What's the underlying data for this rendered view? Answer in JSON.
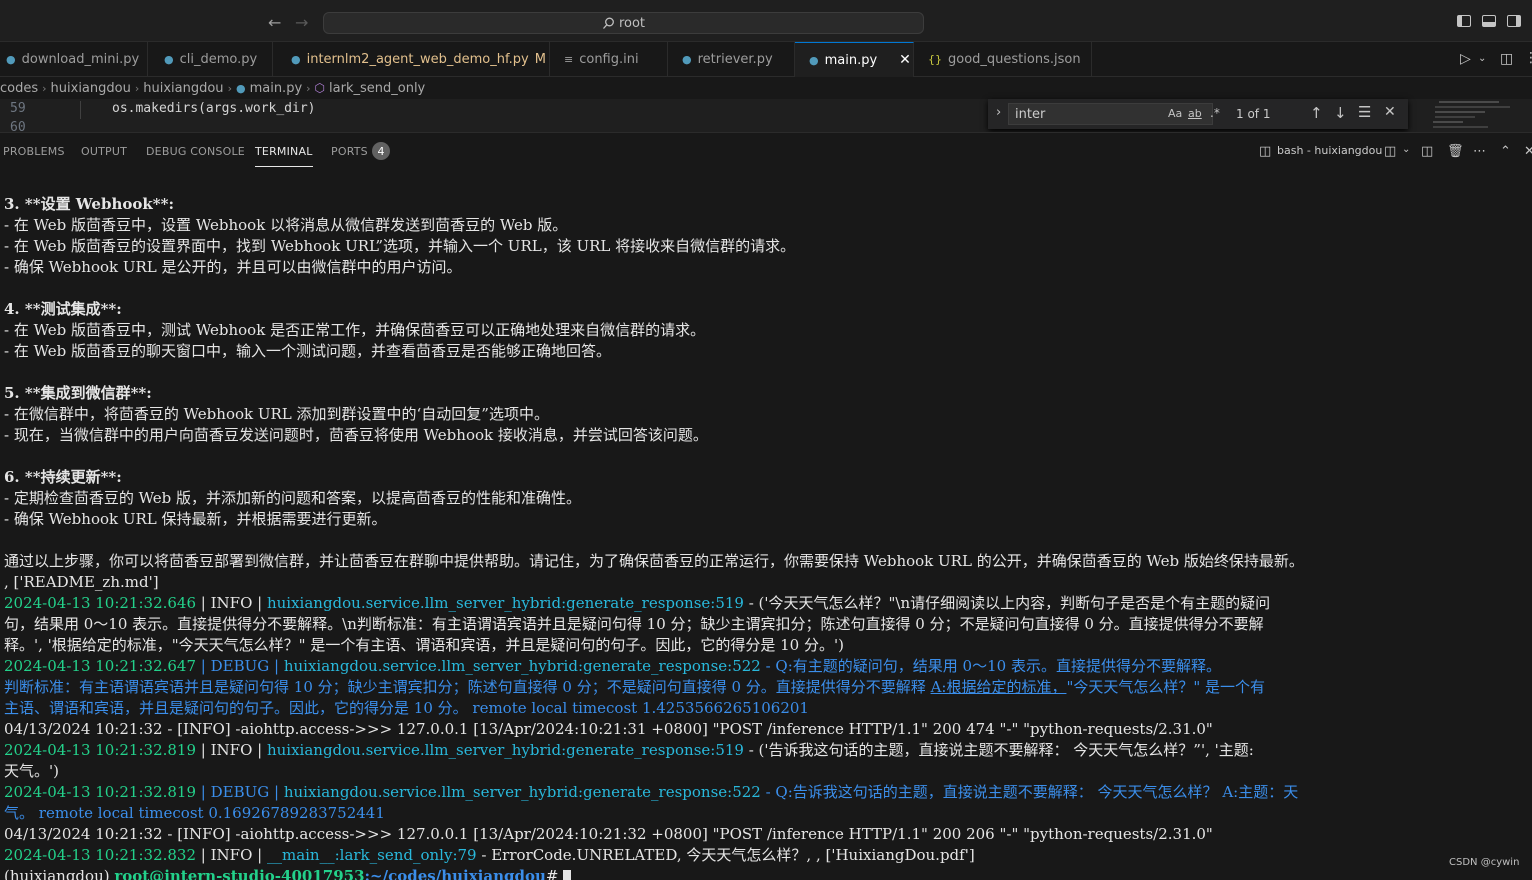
{
  "titlebar": {
    "search": "root"
  },
  "tabs": [
    {
      "label": "download_mini.py",
      "type": "py"
    },
    {
      "label": "cli_demo.py",
      "type": "py"
    },
    {
      "label": "internlm2_agent_web_demo_hf.py",
      "type": "py",
      "badge": "M"
    },
    {
      "label": "config.ini",
      "type": "ini"
    },
    {
      "label": "retriever.py",
      "type": "py"
    },
    {
      "label": "main.py",
      "type": "py",
      "active": true
    },
    {
      "label": "good_questions.json",
      "type": "json"
    }
  ],
  "breadcrumb": [
    "codes",
    "huixiangdou",
    "huixiangdou",
    "main.py",
    "lark_send_only"
  ],
  "editor": {
    "lines": [
      {
        "num": "59",
        "code": "os.makedirs(args.work_dir)"
      },
      {
        "num": "60",
        "code": ""
      }
    ]
  },
  "find": {
    "value": "inter",
    "case": "Aa",
    "word": "ab",
    "regex": ".*",
    "result": "1 of 1"
  },
  "panel": {
    "tabs": [
      "PROBLEMS",
      "OUTPUT",
      "DEBUG CONSOLE",
      "TERMINAL",
      "PORTS"
    ],
    "ports_count": "4",
    "shell": "bash - huixiangdou"
  },
  "terminal": {
    "l1": "3. **设置 Webhook**:",
    "l2": "   - 在 Web 版茴香豆中，设置 Webhook 以将消息从微信群发送到茴香豆的 Web 版。",
    "l3": "   - 在 Web 版茴香豆的设置界面中，找到 Webhook URL”选项，并输入一个 URL，该 URL 将接收来自微信群的请求。",
    "l4": "   - 确保 Webhook URL 是公开的，并且可以由微信群中的用户访问。",
    "l5": "4. **测试集成**:",
    "l6": "   - 在 Web 版茴香豆中，测试 Webhook 是否正常工作，并确保茴香豆可以正确地处理来自微信群的请求。",
    "l7": "   - 在 Web 版茴香豆的聊天窗口中，输入一个测试问题，并查看茴香豆是否能够正确地回答。",
    "l8": "5. **集成到微信群**:",
    "l9": "   - 在微信群中，将茴香豆的 Webhook URL 添加到群设置中的‘自动回复”选项中。",
    "l10": "   - 现在，当微信群中的用户向茴香豆发送问题时，茴香豆将使用 Webhook 接收消息，并尝试回答该问题。",
    "l11": "6. **持续更新**:",
    "l12": "   - 定期检查茴香豆的 Web 版，并添加新的问题和答案，以提高茴香豆的性能和准确性。",
    "l13": "   - 确保 Webhook URL 保持最新，并根据需要进行更新。",
    "l14": "通过以上步骤，你可以将茴香豆部署到微信群，并让茴香豆在群聊中提供帮助。请记住，为了确保茴香豆的正常运行，你需要保持 Webhook URL 的公开，并确保茴香豆的 Web 版始终保持最新。",
    "l15": ", ['README_zh.md']",
    "log1_ts": "2024-04-13 10:21:32.646",
    "log1_lvl": " | INFO     | ",
    "log1_src": "huixiangdou.service.llm_server_hybrid:generate_response:519",
    "log1_msg": " - ('今天天气怎么样？\"\\n请仔细阅读以上内容，判断句子是否是个有主题的疑问",
    "log1_c1": "句，结果用 0～10 表示。直接提供得分不要解释。\\n判断标准：有主语谓语宾语并且是疑问句得 10 分；缺少主谓宾扣分；陈述句直接得 0 分；不是疑问句直接得 0 分。直接提供得分不要解",
    "log1_c2": "释。', '根据给定的标准，\"今天天气怎么样？\" 是一个有主语、谓语和宾语，并且是疑问句的句子。因此，它的得分是 10 分。')",
    "log2_ts": "2024-04-13 10:21:32.647",
    "log2_lvl": " | DEBUG    | ",
    "log2_src": "huixiangdou.service.llm_server_hybrid:generate_response:522",
    "log2_msg": " - Q:有主题的疑问句，结果用 0～10 表示。直接提供得分不要解释。",
    "log2_c1a": "判断标准：有主语谓语宾语并且是疑问句得 10 分；缺少主谓宾扣分；陈述句直接得 0 分；不是疑问句直接得 0 分。直接提供得分不要解释 ",
    "log2_c1b": "A:根据给定的标准，",
    "log2_c1c": "\"今天天气怎么样？\" 是一个有",
    "log2_c2": "主语、谓语和宾语，并且是疑问句的句子。因此，它的得分是 10 分。           remote local timecost 1.4253566265106201",
    "access1": "04/13/2024 10:21:32 - [INFO] -aiohttp.access->>>    127.0.0.1 [13/Apr/2024:10:21:31 +0800] \"POST /inference HTTP/1.1\" 200 474 \"-\" \"python-requests/2.31.0\"",
    "log3_ts": "2024-04-13 10:21:32.819",
    "log3_lvl": " | INFO     | ",
    "log3_src": "huixiangdou.service.llm_server_hybrid:generate_response:519",
    "log3_msg": " - ('告诉我这句话的主题，直接说主题不要解释： 今天天气怎么样？”', '主题:",
    "log3_c1": "天气。')",
    "log4_ts": "2024-04-13 10:21:32.819",
    "log4_lvl": " | DEBUG    | ",
    "log4_src": "huixiangdou.service.llm_server_hybrid:generate_response:522",
    "log4_msg": " - Q:告诉我这句话的主题，直接说主题不要解释： 今天天气怎么样？ A:主题：天",
    "log4_c1": "气。           remote local timecost 0.16926789283752441",
    "access2": "04/13/2024 10:21:32 - [INFO] -aiohttp.access->>>    127.0.0.1 [13/Apr/2024:10:21:32 +0800] \"POST /inference HTTP/1.1\" 200 206 \"-\" \"python-requests/2.31.0\"",
    "log5_ts": "2024-04-13 10:21:32.832",
    "log5_lvl": " | INFO     | ",
    "log5_src": "__main__:lark_send_only:79",
    "log5_msg": " - ErrorCode.UNRELATED, 今天天气怎么样？, , ['HuixiangDou.pdf']",
    "prompt_env": "(huixiangdou) ",
    "prompt_user": "root@intern-studio-40017953",
    "prompt_path": ":~/codes/huixiangdou",
    "prompt_end": "# "
  },
  "watermark": "CSDN @cywin",
  "colors": {
    "accent": "#0078d4",
    "log_green": "#23d18b",
    "log_cyan": "#29b8db",
    "log_blue": "#3b8eea"
  }
}
